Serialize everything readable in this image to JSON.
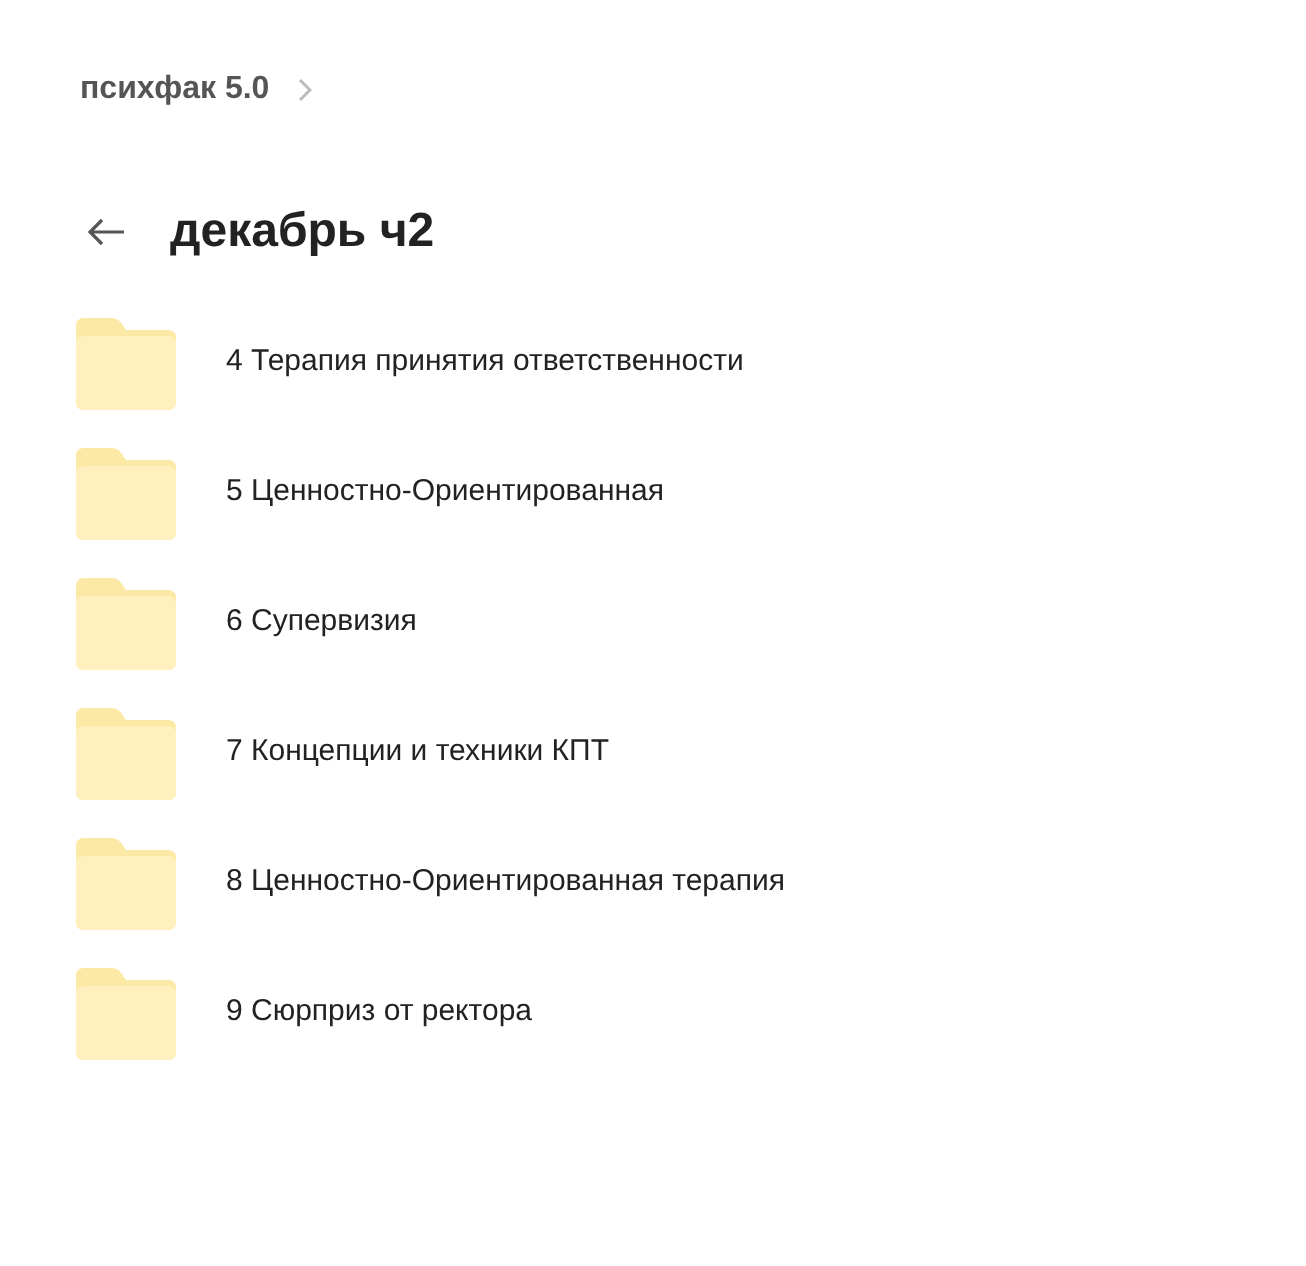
{
  "breadcrumb": {
    "label": "психфак 5.0"
  },
  "title": "декабрь ч2",
  "folders": [
    {
      "name": "4 Терапия принятия ответственности"
    },
    {
      "name": "5 Ценностно-Ориентированная"
    },
    {
      "name": "6 Супервизия"
    },
    {
      "name": "7 Концепции и техники КПТ"
    },
    {
      "name": "8 Ценностно-Ориентированная терапия"
    },
    {
      "name": "9 Сюрприз от ректора"
    }
  ]
}
